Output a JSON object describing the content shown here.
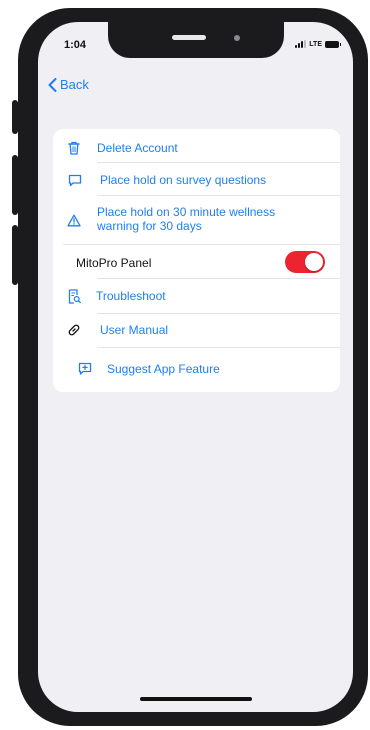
{
  "status_bar": {
    "time": "1:04",
    "network": "LTE"
  },
  "nav": {
    "back_label": "Back"
  },
  "menu": {
    "delete_account": "Delete Account",
    "hold_survey": "Place hold on survey questions",
    "hold_wellness_line1": "Place hold on 30 minute wellness",
    "hold_wellness_line2": "warning for 30 days",
    "mitopro_panel": "MitoPro Panel",
    "mitopro_panel_enabled": true,
    "troubleshoot": "Troubleshoot",
    "user_manual": "User Manual",
    "suggest_feature": "Suggest App Feature"
  },
  "colors": {
    "accent": "#1f7ff0",
    "toggle_on": "#ee2330",
    "background": "#efeff4"
  }
}
